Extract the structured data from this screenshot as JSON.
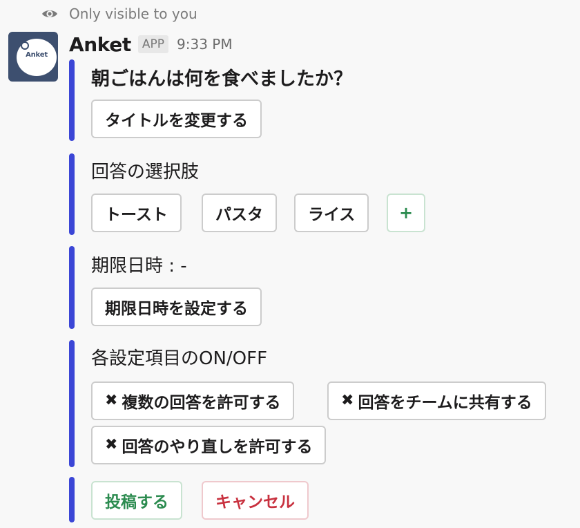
{
  "ephemeral": {
    "icon": "eye-icon",
    "text": "Only visible to you"
  },
  "message": {
    "avatar_text": "Anket",
    "sender": "Anket",
    "badge": "APP",
    "time": "9:33 PM"
  },
  "colors": {
    "accent_bar": "#3b46d6",
    "primary": "#2b8b4f",
    "danger": "#c8313f",
    "avatar_bg": "#3d4f6f"
  },
  "poll": {
    "question": "朝ごはんは何を食べましたか？",
    "rename_button": "タイトルを変更する",
    "choices_label": "回答の選択肢",
    "choices": [
      "トースト",
      "パスタ",
      "ライス"
    ],
    "add_choice": "+",
    "deadline_label": "期限日時 : -",
    "set_deadline_button": "期限日時を設定する",
    "settings_label": "各設定項目のON/OFF",
    "settings": [
      {
        "icon": "✖",
        "label": "複数の回答を許可する"
      },
      {
        "icon": "✖",
        "label": "回答をチームに共有する"
      },
      {
        "icon": "✖",
        "label": "回答のやり直しを許可する"
      }
    ],
    "submit_button": "投稿する",
    "cancel_button": "キャンセル"
  }
}
